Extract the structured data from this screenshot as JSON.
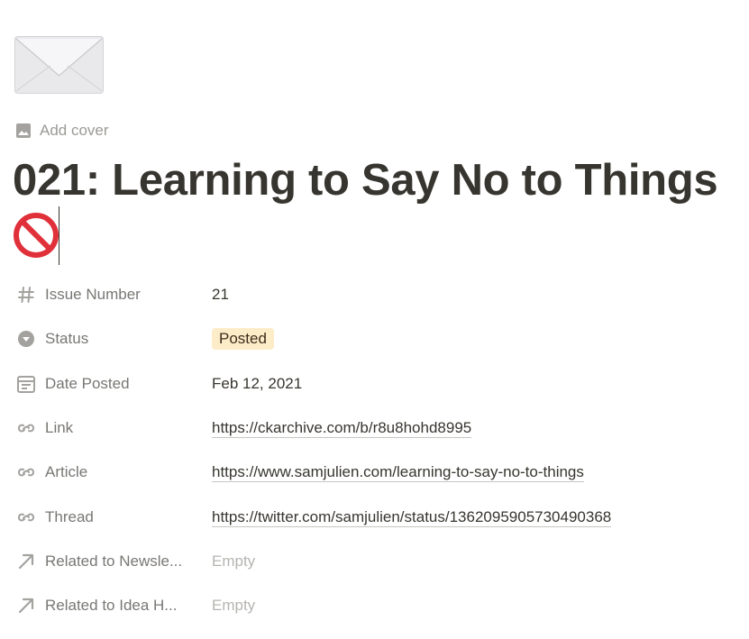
{
  "page_icon": "envelope-icon",
  "add_cover_label": "Add cover",
  "title": {
    "text": "021: Learning to Say No to Things",
    "emoji": "no-entry-sign-icon"
  },
  "properties": [
    {
      "icon": "hash-icon",
      "name": "Issue Number",
      "value": "21"
    },
    {
      "icon": "select-icon",
      "name": "Status",
      "value": "Posted",
      "badge_color": "#fdecc8"
    },
    {
      "icon": "calendar-icon",
      "name": "Date Posted",
      "value": "Feb 12, 2021"
    },
    {
      "icon": "link-icon",
      "name": "Link",
      "value": "https://ckarchive.com/b/r8u8hohd8995"
    },
    {
      "icon": "link-icon",
      "name": "Article",
      "value": "https://www.samjulien.com/learning-to-say-no-to-things"
    },
    {
      "icon": "link-icon",
      "name": "Thread",
      "value": "https://twitter.com/samjulien/status/1362095905730490368"
    },
    {
      "icon": "arrow-up-right-icon",
      "name": "Related to Newsle...",
      "value": "Empty"
    },
    {
      "icon": "arrow-up-right-icon",
      "name": "Related to Idea H...",
      "value": "Empty"
    }
  ],
  "colors": {
    "text": "#37352f",
    "muted": "#787774",
    "placeholder": "#b5b4b1"
  }
}
